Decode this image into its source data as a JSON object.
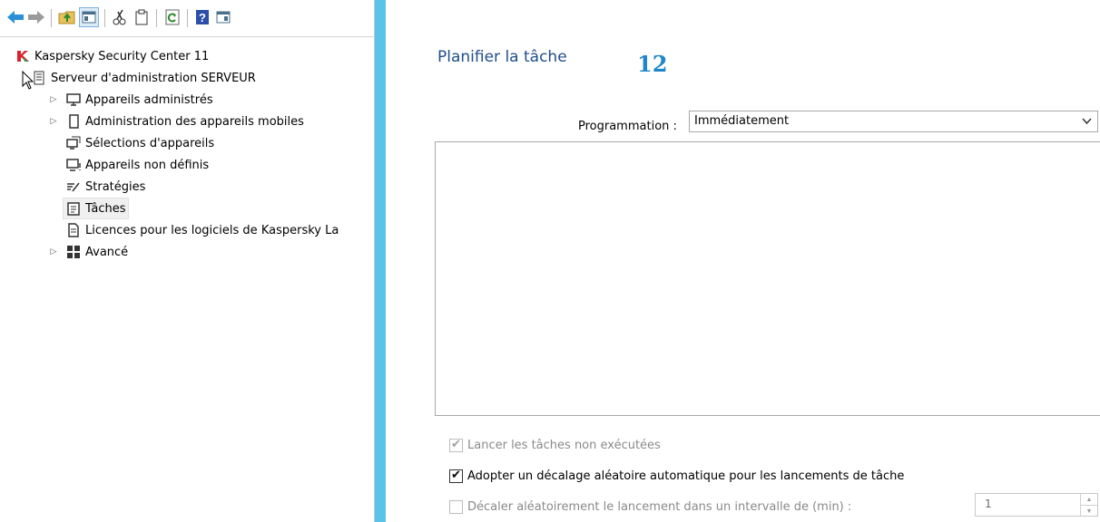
{
  "toolbar": {
    "items": [
      "back-arrow-icon",
      "forward-arrow-icon",
      "folder-up-icon",
      "console-tree-icon",
      "cut-icon",
      "paste-icon",
      "refresh-icon",
      "help-icon",
      "action-pane-icon"
    ]
  },
  "tree": {
    "root": "Kaspersky Security Center 11",
    "server": "Serveur d'administration SERVEUR",
    "items": [
      {
        "label": "Appareils administrés",
        "expandable": true
      },
      {
        "label": "Administration des appareils mobiles",
        "expandable": true
      },
      {
        "label": "Sélections d'appareils",
        "expandable": false
      },
      {
        "label": "Appareils non définis",
        "expandable": false
      },
      {
        "label": "Stratégies",
        "expandable": false
      },
      {
        "label": "Tâches",
        "expandable": false,
        "selected": true
      },
      {
        "label": "Licences pour les logiciels de Kaspersky La",
        "expandable": false
      },
      {
        "label": "Avancé",
        "expandable": true
      }
    ]
  },
  "wizard": {
    "title": "Planifier la tâche",
    "step_number": "12",
    "programmation_label": "Programmation :",
    "programmation_value": "Immédiatement",
    "checkboxes": {
      "run_missed": {
        "label": "Lancer les tâches non exécutées",
        "checked": true,
        "disabled": true
      },
      "auto_random_delay": {
        "label": "Adopter un décalage aléatoire automatique pour les lancements de tâche",
        "checked": true,
        "disabled": false
      },
      "random_delay_interval": {
        "label": "Décaler aléatoirement le lancement dans un intervalle de (min) :",
        "checked": false,
        "disabled": true
      }
    },
    "interval_value": "1"
  },
  "colors": {
    "accent": "#5ac3e8",
    "title": "#1f4e8c",
    "step_number": "#1f87c9"
  }
}
